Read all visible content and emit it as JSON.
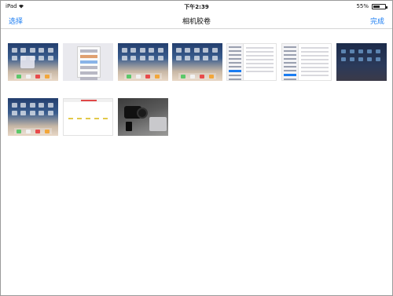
{
  "status_bar": {
    "device": "iPad",
    "wifi_icon": "wifi-icon",
    "time": "下午2:39",
    "battery_percent": "55%",
    "battery_level": 0.55
  },
  "nav": {
    "left_label": "选择",
    "title": "相机胶卷",
    "right_label": "完成"
  },
  "photos": [
    {
      "kind": "home-screen-popup"
    },
    {
      "kind": "app-store-sheet"
    },
    {
      "kind": "home-screen"
    },
    {
      "kind": "home-screen"
    },
    {
      "kind": "settings"
    },
    {
      "kind": "settings"
    },
    {
      "kind": "dark-home-screen"
    },
    {
      "kind": "home-screen"
    },
    {
      "kind": "chart"
    },
    {
      "kind": "camera-photo"
    }
  ]
}
